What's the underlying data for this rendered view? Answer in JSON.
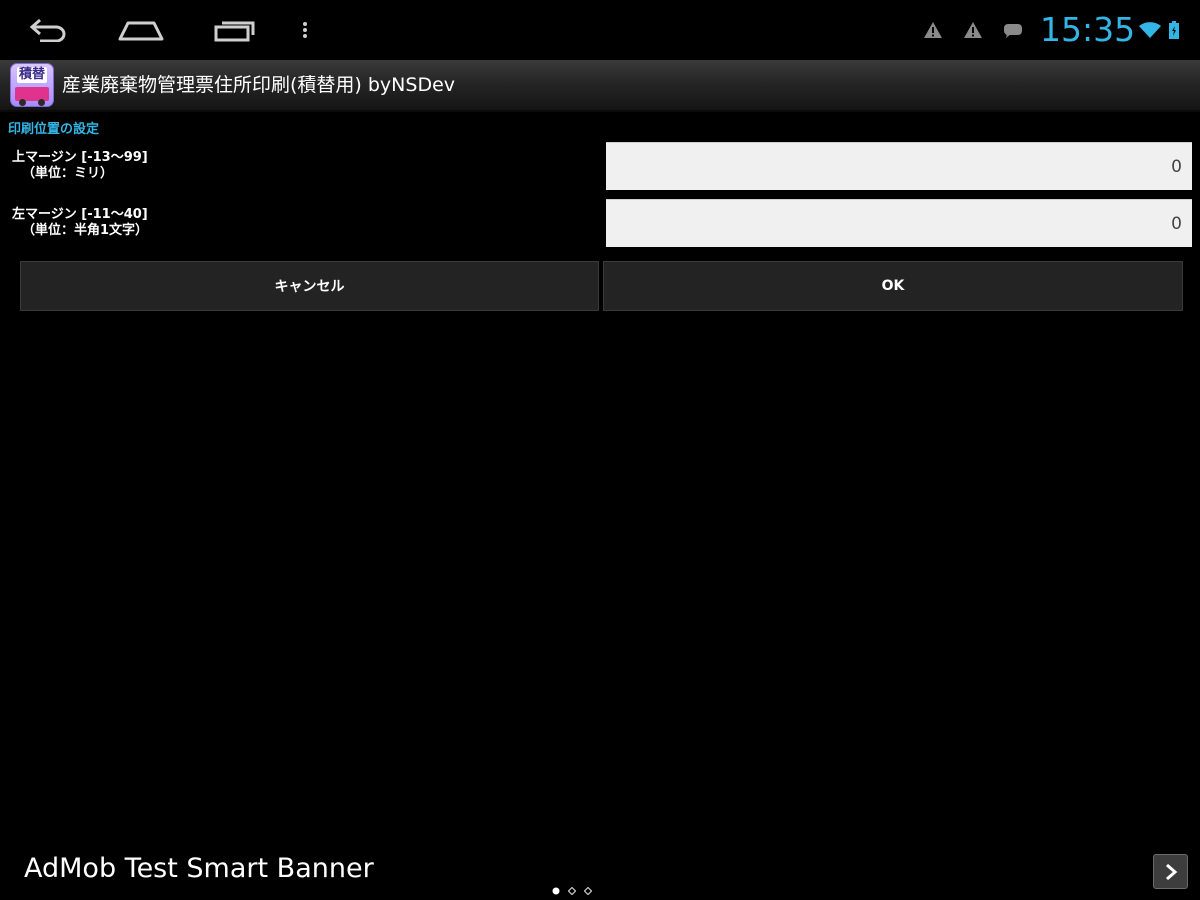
{
  "status_bar": {
    "clock": "15:35",
    "icons": [
      "back-icon",
      "home-icon",
      "recent-apps-icon",
      "overflow-menu-icon",
      "warning-icon",
      "warning-icon",
      "chat-icon",
      "wifi-icon",
      "battery-icon"
    ],
    "clock_color": "#33b5e5"
  },
  "action_bar": {
    "icon_label": "積替",
    "title": "産業廃棄物管理票住所印刷(積替用) byNSDev"
  },
  "settings": {
    "section_header": "印刷位置の設定",
    "top_margin": {
      "label_line1": "上マージン [-13～99]",
      "label_line2": "（単位：ミリ）",
      "value": "0"
    },
    "left_margin": {
      "label_line1": "左マージン [-11～40]",
      "label_line2": "（単位：半角1文字）",
      "value": "0"
    }
  },
  "buttons": {
    "cancel_label": "キャンセル",
    "ok_label": "OK"
  },
  "ad_banner": {
    "text": "AdMob Test Smart Banner",
    "page_count": 3,
    "active_page": 1
  },
  "colors": {
    "accent": "#33b5e5",
    "background": "#000000",
    "input_background": "#f0f0f0",
    "button_background": "#232323"
  }
}
